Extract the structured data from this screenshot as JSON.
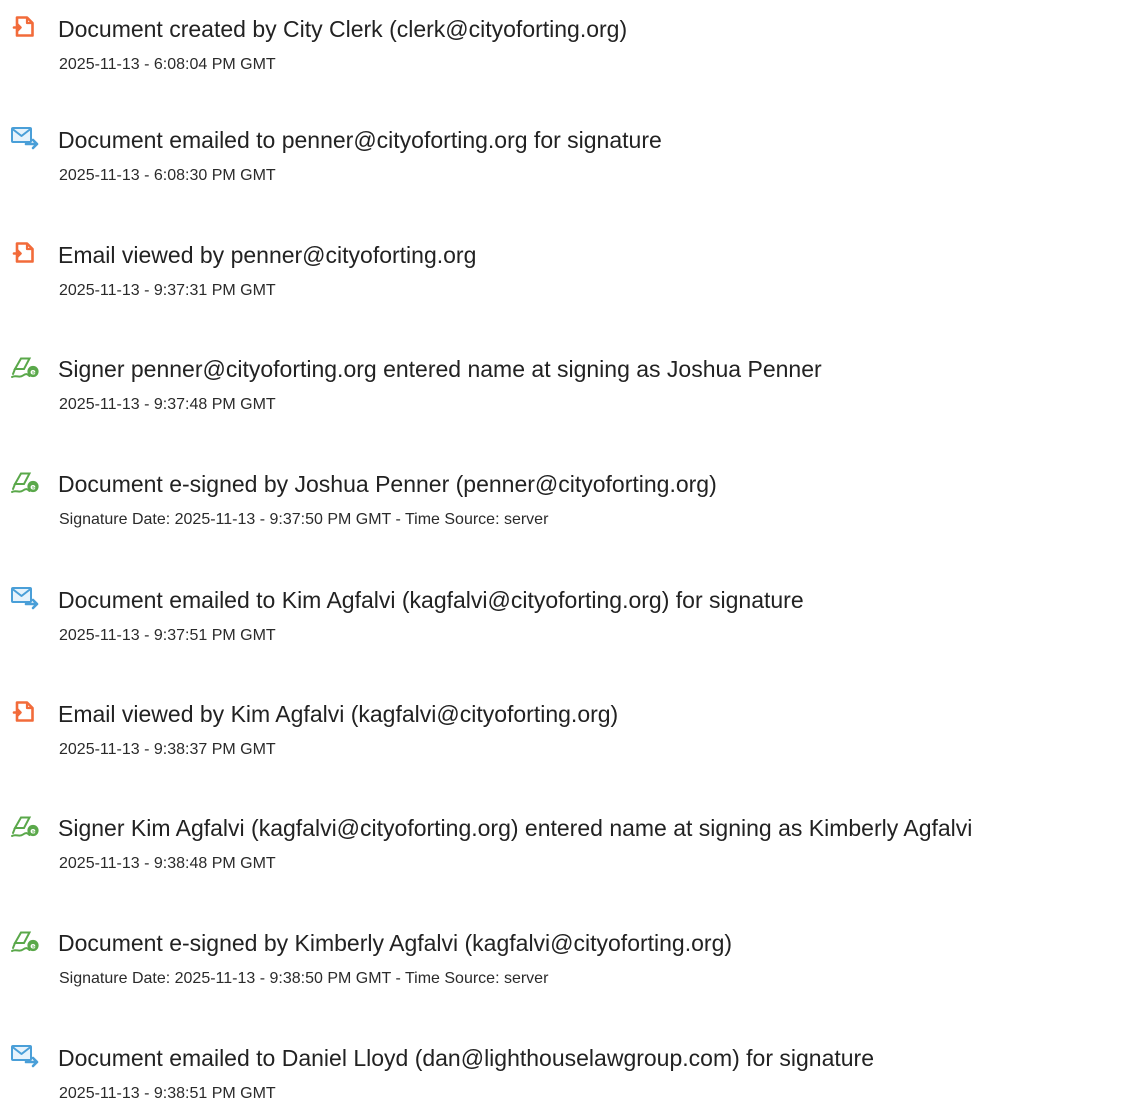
{
  "colors": {
    "document_icon": "#f26b3a",
    "email_icon": "#4a9fd8",
    "signature_icon": "#5aa84a",
    "text": "#222222"
  },
  "events": [
    {
      "icon": "document-icon",
      "title": "Document created by City Clerk (clerk@cityoforting.org)",
      "time": "2025-11-13 - 6:08:04 PM GMT"
    },
    {
      "icon": "email-icon",
      "title": "Document emailed to penner@cityoforting.org for signature",
      "time": "2025-11-13 - 6:08:30 PM GMT"
    },
    {
      "icon": "document-icon",
      "title": "Email viewed by penner@cityoforting.org",
      "time": "2025-11-13 - 9:37:31 PM GMT"
    },
    {
      "icon": "signature-icon",
      "title": "Signer penner@cityoforting.org entered name at signing as Joshua Penner",
      "time": "2025-11-13 - 9:37:48 PM GMT"
    },
    {
      "icon": "signature-icon",
      "title": "Document e-signed by Joshua Penner (penner@cityoforting.org)",
      "time": "Signature Date: 2025-11-13 - 9:37:50 PM GMT - Time Source: server"
    },
    {
      "icon": "email-icon",
      "title": "Document emailed to Kim Agfalvi (kagfalvi@cityoforting.org) for signature",
      "time": "2025-11-13 - 9:37:51 PM GMT"
    },
    {
      "icon": "document-icon",
      "title": "Email viewed by Kim Agfalvi (kagfalvi@cityoforting.org)",
      "time": "2025-11-13 - 9:38:37 PM GMT"
    },
    {
      "icon": "signature-icon",
      "title": "Signer Kim Agfalvi (kagfalvi@cityoforting.org) entered name at signing as Kimberly Agfalvi",
      "time": "2025-11-13 - 9:38:48 PM GMT"
    },
    {
      "icon": "signature-icon",
      "title": "Document e-signed by Kimberly Agfalvi (kagfalvi@cityoforting.org)",
      "time": "Signature Date: 2025-11-13 - 9:38:50 PM GMT - Time Source: server"
    },
    {
      "icon": "email-icon",
      "title": "Document emailed to Daniel Lloyd (dan@lighthouselawgroup.com) for signature",
      "time": "2025-11-13 - 9:38:51 PM GMT"
    }
  ]
}
